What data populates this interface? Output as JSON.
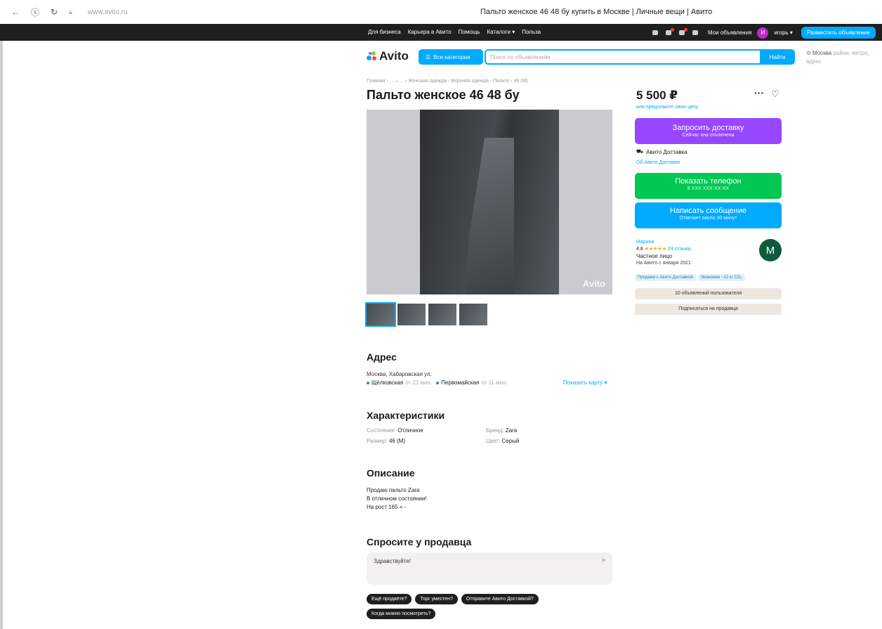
{
  "browser": {
    "url": "www.avito.ru",
    "page_title": "Пальто женское 46 48 бу купить в Москве | Личные вещи | Авито"
  },
  "topnav": {
    "links": [
      "Для бизнеса",
      "Карьера в Авито",
      "Помощь",
      "Каталоги",
      "Польза"
    ],
    "my_ads": "Мои объявления",
    "user_initial": "И",
    "user_name": "игорь",
    "post_button": "Разместить объявление"
  },
  "header": {
    "logo": "Avito",
    "all_categories": "Все категории",
    "search_placeholder": "Поиск по объявлениям",
    "search_button": "Найти",
    "location": "Москва",
    "location_sub": "район, метро, адрес"
  },
  "listing": {
    "breadcrumbs": "Главная › … › … › Женская одежда › Верхняя одежда › Пальто › 46 (M)",
    "title": "Пальто женское 46 48 бу",
    "watermark": "Avito"
  },
  "address": {
    "heading": "Адрес",
    "line": "Москва, Хабаровская ул.",
    "metro": [
      {
        "name": "Щёлковская",
        "time": "от 21 мин.",
        "color": "#1a8fd6"
      },
      {
        "name": "Первомайская",
        "time": "от 11 мин.",
        "color": "#1a8fd6"
      }
    ],
    "show_map": "Показать карту"
  },
  "specs": {
    "heading": "Характеристики",
    "items": [
      {
        "key": "Состояние:",
        "value": "Отличное"
      },
      {
        "key": "Бренд:",
        "value": "Zara"
      },
      {
        "key": "Размер:",
        "value": "46 (M)"
      },
      {
        "key": "Цвет:",
        "value": "Серый"
      }
    ]
  },
  "description": {
    "heading": "Описание",
    "lines": [
      "Продаю пальто Zara",
      "В отличном состоянии!",
      "На рост 165 + -"
    ]
  },
  "ask": {
    "heading": "Спросите у продавца",
    "input_value": "Здравствуйте!",
    "chips": [
      "Ещё продаёте?",
      "Торг уместен?",
      "Отправите Авито Доставкой?",
      "Когда можно посмотреть?"
    ]
  },
  "purchase": {
    "price": "5 500 ₽",
    "price_link": "или предложите свою цену",
    "delivery_button": "Запросить доставку",
    "delivery_sub": "Сейчас она отключена",
    "delivery_label": "Авито Доставка",
    "delivery_link": "Об Авито Доставке",
    "phone_button": "Показать телефон",
    "phone_sub": "8 XXX XXX-XX-XX",
    "message_button": "Написать сообщение",
    "message_sub": "Отвечает около 30 минут"
  },
  "seller": {
    "name": "Марина",
    "rating": "4,8",
    "stars": "★★★★★",
    "reviews": "24 отзыва",
    "type": "Частное лицо",
    "since": "На Авито с января 2021",
    "initial": "М",
    "badges": [
      "Продажи с Авито Доставкой",
      "Экономия ~12 кг CO₂"
    ],
    "all_ads_button": "10 объявлений пользователя",
    "subscribe_button": "Подписаться на продавца"
  }
}
